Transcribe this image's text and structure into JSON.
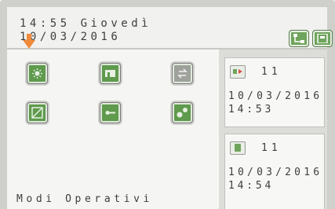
{
  "header": {
    "time_day": "14:55 Giovedì",
    "date": "10/03/2016"
  },
  "icons": [
    {
      "name": "sun-mode-icon",
      "color": "green"
    },
    {
      "name": "sauna-icon",
      "color": "green"
    },
    {
      "name": "swap-icon",
      "color": "gray"
    },
    {
      "name": "panel-icon",
      "color": "green"
    },
    {
      "name": "key-icon",
      "color": "green"
    },
    {
      "name": "molecule-icon",
      "color": "green"
    }
  ],
  "footer": {
    "label": "Modi Operativi"
  },
  "events": [
    {
      "number": "11",
      "date": "10/03/2016",
      "time": "14:53",
      "icon": "sensor-icon"
    },
    {
      "number": "11",
      "date": "10/03/2016",
      "time": "14:54",
      "icon": "device-icon"
    }
  ],
  "colors": {
    "accent": "#5f9a4d",
    "arrow": "#f08a3a",
    "frame": "#cfd0cc"
  }
}
